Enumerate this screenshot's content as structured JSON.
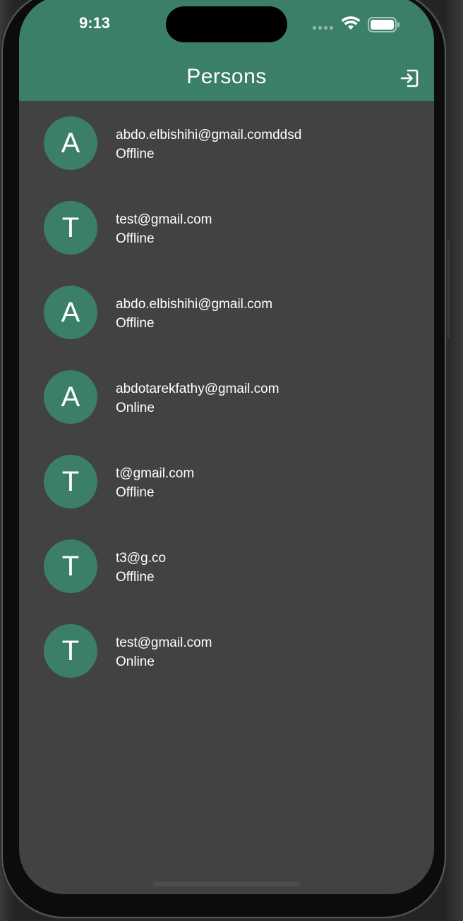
{
  "status_bar": {
    "time": "9:13"
  },
  "app_bar": {
    "title": "Persons",
    "logout_icon": "logout-icon",
    "color": "#3b7f68"
  },
  "persons": [
    {
      "initial": "A",
      "email": "abdo.elbishihi@gmail.comddsd",
      "status": "Offline"
    },
    {
      "initial": "T",
      "email": "test@gmail.com",
      "status": "Offline"
    },
    {
      "initial": "A",
      "email": "abdo.elbishihi@gmail.com",
      "status": "Offline"
    },
    {
      "initial": "A",
      "email": "abdotarekfathy@gmail.com",
      "status": "Online"
    },
    {
      "initial": "T",
      "email": "t@gmail.com",
      "status": "Offline"
    },
    {
      "initial": "T",
      "email": "t3@g.co",
      "status": "Offline"
    },
    {
      "initial": "T",
      "email": "test@gmail.com",
      "status": "Online"
    }
  ],
  "colors": {
    "background": "#424242",
    "avatar": "#3b7f68",
    "text": "#ffffff"
  }
}
